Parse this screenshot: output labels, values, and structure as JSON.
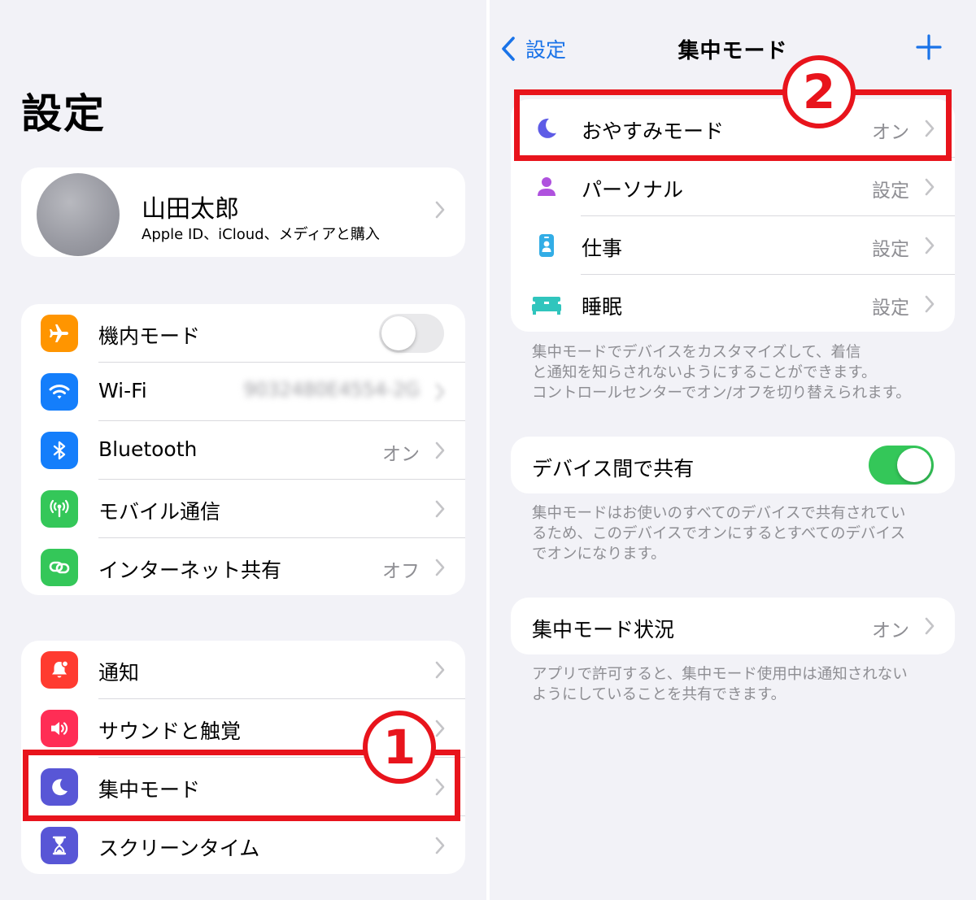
{
  "left": {
    "title": "設定",
    "profile": {
      "name": "山田太郎",
      "subtitle": "Apple ID、iCloud、メディアと購入"
    },
    "connectivity": [
      {
        "label": "機内モード",
        "icon": "airplane-icon",
        "color": "#ff9500",
        "toggle": "off"
      },
      {
        "label": "Wi-Fi",
        "value": "9032480E4554-2G",
        "icon": "wifi-icon",
        "color": "#147efb"
      },
      {
        "label": "Bluetooth",
        "value": "オン",
        "icon": "bluetooth-icon",
        "color": "#147efb"
      },
      {
        "label": "モバイル通信",
        "icon": "antenna-icon",
        "color": "#34c759"
      },
      {
        "label": "インターネット共有",
        "value": "オフ",
        "icon": "link-icon",
        "color": "#34c759"
      }
    ],
    "notifications": [
      {
        "label": "通知",
        "icon": "bell-icon",
        "color": "#ff3b30"
      },
      {
        "label": "サウンドと触覚",
        "icon": "speaker-icon",
        "color": "#ff2d55"
      },
      {
        "label": "集中モード",
        "icon": "moon-icon",
        "color": "#5856d6"
      },
      {
        "label": "スクリーンタイム",
        "icon": "hourglass-icon",
        "color": "#5856d6"
      }
    ],
    "step_marker": "1"
  },
  "right": {
    "back_label": "設定",
    "title": "集中モード",
    "focus_modes": [
      {
        "label": "おやすみモード",
        "value": "オン",
        "icon": "moon-icon",
        "color": "#5e5ce6"
      },
      {
        "label": "パーソナル",
        "value": "設定",
        "icon": "person-icon",
        "color": "#af52de"
      },
      {
        "label": "仕事",
        "value": "設定",
        "icon": "id-badge-icon",
        "color": "#32ade6"
      },
      {
        "label": "睡眠",
        "value": "設定",
        "icon": "bed-icon",
        "color": "#30c5bd"
      }
    ],
    "focus_note": [
      "集中モードでデバイスをカスタマイズして、着信",
      "と通知を知らされないようにすることができます。",
      "コントロールセンターでオン/オフを切り替えられます。"
    ],
    "share": {
      "label": "デバイス間で共有",
      "toggle": "on",
      "toggle_color": "#34c759"
    },
    "share_note": [
      "集中モードはお使いのすべてのデバイスで共有されてい",
      "るため、このデバイスでオンにするとすべてのデバイス",
      "でオンになります。"
    ],
    "status": {
      "label": "集中モード状況",
      "value": "オン"
    },
    "status_note": [
      "アプリで許可すると、集中モード使用中は通知されない",
      "ようにしていることを共有できます。"
    ],
    "step_marker": "2"
  },
  "colors": {
    "accent": "#1a73e8",
    "highlight": "#e8141c",
    "background": "#f2f2f7",
    "secondary_text": "#8e8e93"
  }
}
